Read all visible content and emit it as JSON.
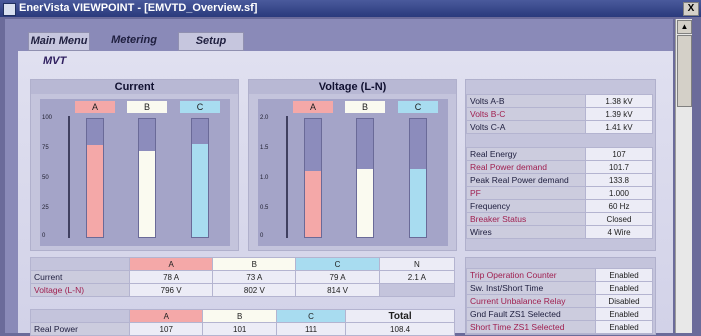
{
  "window": {
    "title": "EnerVista VIEWPOINT - [EMVTD_Overview.sf]",
    "close_glyph": "X"
  },
  "menu": {
    "main_menu": "Main Menu",
    "metering": "Metering",
    "setup": "Setup"
  },
  "device_label": "MVT",
  "current_chart": {
    "title": "Current",
    "phases": [
      "A",
      "B",
      "C"
    ],
    "ticks": [
      "100",
      "75",
      "50",
      "25",
      "0"
    ],
    "fill_fraction": [
      0.78,
      0.73,
      0.79
    ],
    "colors": {
      "A": "#f4a8a8",
      "B": "#fafaf0",
      "C": "#a8dcf0"
    }
  },
  "voltage_chart": {
    "title": "Voltage (L-N)",
    "phases": [
      "A",
      "B",
      "C"
    ],
    "ticks": [
      "2.0",
      "1.5",
      "1.0",
      "0.5",
      "0"
    ],
    "fill_fraction": [
      0.56,
      0.58,
      0.58
    ]
  },
  "line_voltages": [
    {
      "label": "Volts A-B",
      "value": "1.38 kV",
      "red": false
    },
    {
      "label": "Volts B-C",
      "value": "1.39 kV",
      "red": true
    },
    {
      "label": "Volts C-A",
      "value": "1.41 kV",
      "red": false
    }
  ],
  "power_info": [
    {
      "label": "Real Energy",
      "value": "107",
      "red": false
    },
    {
      "label": "Real Power demand",
      "value": "101.7",
      "red": true
    },
    {
      "label": "Peak Real Power demand",
      "value": "133.8",
      "red": false
    },
    {
      "label": "PF",
      "value": "1.000",
      "red": true
    },
    {
      "label": "Frequency",
      "value": "60 Hz",
      "red": false
    },
    {
      "label": "Breaker Status",
      "value": "Closed",
      "red": true
    },
    {
      "label": "Wires",
      "value": "4 Wire",
      "red": false
    }
  ],
  "phase_table": {
    "headers": [
      "A",
      "B",
      "C",
      "N"
    ],
    "rows": [
      {
        "label": "Current",
        "values": [
          "78 A",
          "73 A",
          "79 A",
          "2.1 A"
        ],
        "red": false
      },
      {
        "label": "Voltage (L-N)",
        "values": [
          "796 V",
          "802 V",
          "814 V",
          ""
        ],
        "red": true
      }
    ]
  },
  "power_table": {
    "headers": [
      "A",
      "B",
      "C",
      "Total"
    ],
    "rows": [
      {
        "label": "Real Power",
        "values": [
          "107",
          "101",
          "111",
          "108.4"
        ]
      }
    ]
  },
  "protection": [
    {
      "label": "Trip Operation Counter",
      "value": "Enabled",
      "red": true
    },
    {
      "label": "Sw. Inst/Short Time",
      "value": "Enabled",
      "red": false
    },
    {
      "label": "Current Unbalance Relay",
      "value": "Disabled",
      "red": true
    },
    {
      "label": "Gnd Fault ZS1 Selected",
      "value": "Enabled",
      "red": false
    },
    {
      "label": "Short Time ZS1 Selected",
      "value": "Enabled",
      "red": true
    }
  ]
}
